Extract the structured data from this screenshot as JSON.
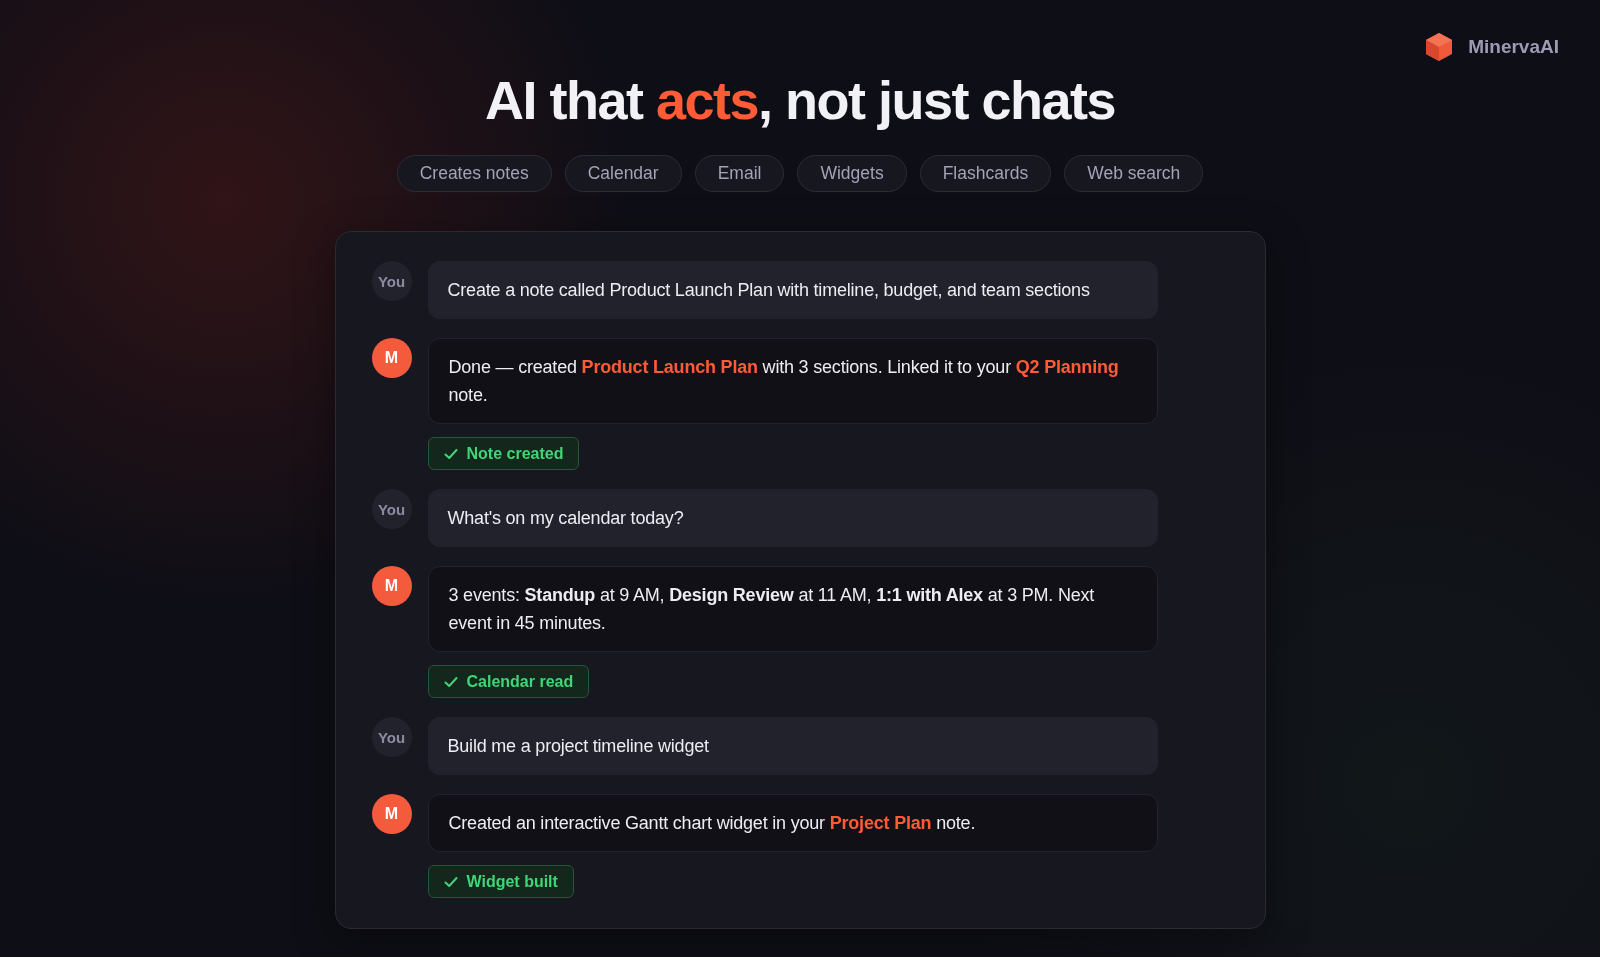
{
  "brand": {
    "name": "MinervaAI"
  },
  "headline": {
    "before": "AI that ",
    "accent": "acts",
    "after": ", not just chats"
  },
  "capabilities": [
    "Creates notes",
    "Calendar",
    "Email",
    "Widgets",
    "Flashcards",
    "Web search"
  ],
  "conversation": [
    {
      "kind": "user",
      "avatar": "You",
      "parts": [
        {
          "kind": "text",
          "text": "Create a note called Product Launch Plan with timeline, budget, and team sections"
        }
      ]
    },
    {
      "kind": "assistant",
      "avatar": "M",
      "parts": [
        {
          "kind": "text",
          "text": "Done — created "
        },
        {
          "kind": "link",
          "text": "Product Launch Plan"
        },
        {
          "kind": "text",
          "text": " with 3 sections. Linked it to your "
        },
        {
          "kind": "link",
          "text": "Q2 Planning"
        },
        {
          "kind": "text",
          "text": " note."
        }
      ],
      "status": "Note created"
    },
    {
      "kind": "user",
      "avatar": "You",
      "parts": [
        {
          "kind": "text",
          "text": "What's on my calendar today?"
        }
      ]
    },
    {
      "kind": "assistant",
      "avatar": "M",
      "parts": [
        {
          "kind": "text",
          "text": "3 events: **Standup** at 9 AM, **Design Review** at 11 AM, **1:1 with Alex** at 3 PM. Next event in 45 minutes."
        }
      ],
      "status": "Calendar read"
    },
    {
      "kind": "user",
      "avatar": "You",
      "parts": [
        {
          "kind": "text",
          "text": "Build me a project timeline widget"
        }
      ]
    },
    {
      "kind": "assistant",
      "avatar": "M",
      "parts": [
        {
          "kind": "text",
          "text": "Created an interactive Gantt chart widget in your "
        },
        {
          "kind": "link",
          "text": "Project Plan"
        },
        {
          "kind": "text",
          "text": " note."
        }
      ],
      "status": "Widget built"
    }
  ]
}
